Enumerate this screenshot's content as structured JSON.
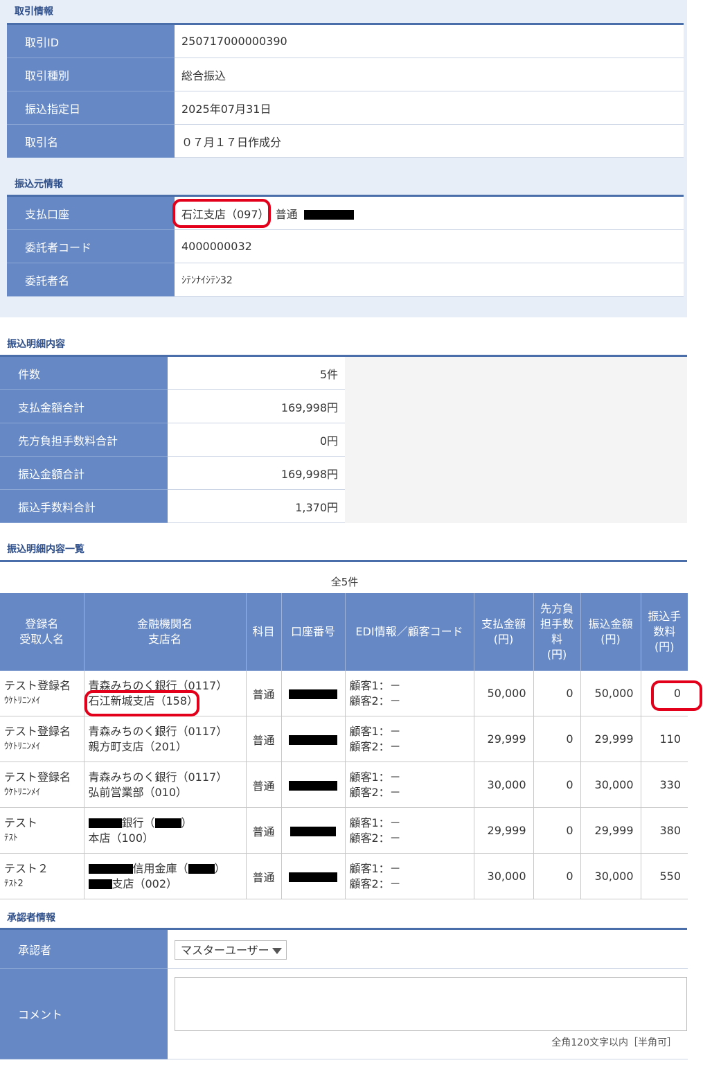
{
  "transaction_section": {
    "title": "取引情報",
    "rows": [
      {
        "label": "取引ID",
        "value": "250717000000390"
      },
      {
        "label": "取引種別",
        "value": "総合振込"
      },
      {
        "label": "振込指定日",
        "value": "2025年07月31日"
      },
      {
        "label": "取引名",
        "value": "０７月１７日作成分"
      }
    ]
  },
  "source_section": {
    "title": "振込元情報",
    "account_label": "支払口座",
    "account_branch": "石江支店（097）",
    "account_type": "普通",
    "rows": [
      {
        "label": "委託者コード",
        "value": "4000000032"
      },
      {
        "label": "委託者名",
        "value": "ｼﾃﾝﾅｲｼﾃﾝ32"
      }
    ]
  },
  "summary_section": {
    "title": "振込明細内容",
    "rows": [
      {
        "label": "件数",
        "value": "5件"
      },
      {
        "label": "支払金額合計",
        "value": "169,998円"
      },
      {
        "label": "先方負担手数料合計",
        "value": "0円"
      },
      {
        "label": "振込金額合計",
        "value": "169,998円"
      },
      {
        "label": "振込手数料合計",
        "value": "1,370円"
      }
    ]
  },
  "list_section": {
    "title": "振込明細内容一覧",
    "count": "全5件",
    "headers": {
      "name_1": "登録名",
      "name_2": "受取人名",
      "bank_1": "金融機関名",
      "bank_2": "支店名",
      "type": "科目",
      "account": "口座番号",
      "edi": "EDI情報／顧客コード",
      "pay_1": "支払金額",
      "pay_2": "(円)",
      "fee_1": "先方負",
      "fee_2": "担手数",
      "fee_3": "料",
      "fee_4": "(円)",
      "amount_1": "振込金額",
      "amount_2": "(円)",
      "tfee_1": "振込手",
      "tfee_2": "数料",
      "tfee_3": "(円)"
    },
    "rows": [
      {
        "name": "テスト登録名",
        "kana": "ｳｹﾄﾘﾆﾝﾒｲ",
        "bank": "青森みちのく銀行（0117）",
        "branch": "石江新城支店（158）",
        "type": "普通",
        "edi1": "顧客1：－",
        "edi2": "顧客2：－",
        "pay": "50,000",
        "fee": "0",
        "amount": "50,000",
        "tfee": "0"
      },
      {
        "name": "テスト登録名",
        "kana": "ｳｹﾄﾘﾆﾝﾒｲ",
        "bank": "青森みちのく銀行（0117）",
        "branch": "親方町支店（201）",
        "type": "普通",
        "edi1": "顧客1：－",
        "edi2": "顧客2：－",
        "pay": "29,999",
        "fee": "0",
        "amount": "29,999",
        "tfee": "110"
      },
      {
        "name": "テスト登録名",
        "kana": "ｳｹﾄﾘﾆﾝﾒｲ",
        "bank": "青森みちのく銀行（0117）",
        "branch": "弘前営業部（010）",
        "type": "普通",
        "edi1": "顧客1：－",
        "edi2": "顧客2：－",
        "pay": "30,000",
        "fee": "0",
        "amount": "30,000",
        "tfee": "330"
      },
      {
        "name": "テスト",
        "kana": "ﾃｽﾄ",
        "bank_suffix": "銀行（",
        "bank_close": "）",
        "branch": "本店（100）",
        "type": "普通",
        "edi1": "顧客1：－",
        "edi2": "顧客2：－",
        "pay": "29,999",
        "fee": "0",
        "amount": "29,999",
        "tfee": "380"
      },
      {
        "name": "テスト２",
        "kana": "ﾃｽﾄ2",
        "bank_suffix": "信用金庫（",
        "bank_close": "）",
        "branch_suffix": "支店（002）",
        "type": "普通",
        "edi1": "顧客1：－",
        "edi2": "顧客2：－",
        "pay": "30,000",
        "fee": "0",
        "amount": "30,000",
        "tfee": "550"
      }
    ]
  },
  "approver_section": {
    "title": "承認者情報",
    "approver_label": "承認者",
    "approver_value": "マスターユーザー",
    "comment_label": "コメント",
    "comment_hint": "全角120文字以内［半角可］"
  },
  "colors": {
    "header_blue": "#6688c4",
    "title_blue": "#2f4f8a",
    "highlight_red": "#e2001a"
  }
}
